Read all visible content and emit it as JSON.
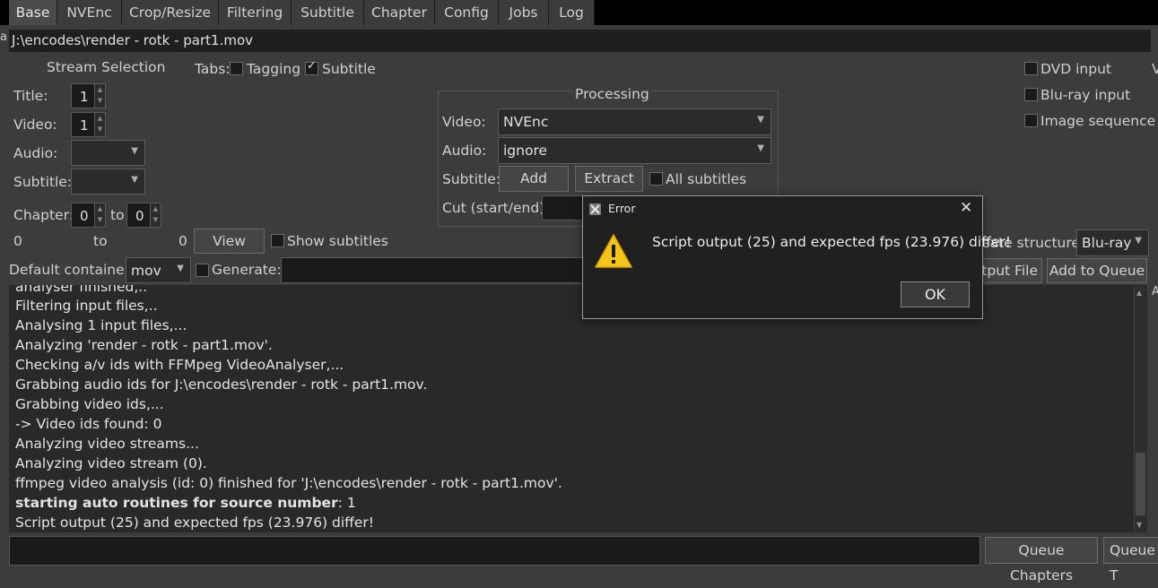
{
  "tabs": [
    "Base",
    "NVEnc",
    "Crop/Resize",
    "Filtering",
    "Subtitle",
    "Chapter",
    "Config",
    "Jobs",
    "Log"
  ],
  "left_mark": "a",
  "source_path": "J:\\encodes\\render - rotk - part1.mov",
  "stream_selection": {
    "title": "Stream Selection",
    "title_label": "Title:",
    "title_value": "1",
    "video_label": "Video:",
    "video_value": "1",
    "audio_label": "Audio:",
    "subtitle_label": "Subtitle:",
    "chapter_label": "Chapter:",
    "chapter_from": "0",
    "chapter_to_label": "to",
    "chapter_to": "0",
    "range_start": "0",
    "range_to": "to",
    "range_end": "0",
    "view_button": "View",
    "show_subtitles": "Show subtitles"
  },
  "tabs_options": {
    "label": "Tabs:",
    "tagging": "Tagging",
    "subtitle": "Subtitle"
  },
  "processing": {
    "title": "Processing",
    "video_label": "Video:",
    "video_value": "NVEnc",
    "audio_label": "Audio:",
    "audio_value": "ignore",
    "subtitle_label": "Subtitle:",
    "add_button": "Add",
    "extract_button": "Extract",
    "all_subtitles": "All subtitles",
    "cut_label": "Cut (start/end):"
  },
  "right_options": {
    "dvd_input": "DVD input",
    "bluray_input": "Blu-ray input",
    "image_sequence": "Image sequence",
    "edge_glyph": "V"
  },
  "container": {
    "label": "Default container:",
    "value": "mov",
    "generate": "Generate:",
    "structure_label": "eate structure:",
    "structure_value": "Blu-ray",
    "output_button": "tput File",
    "add_queue_button": "Add to Queue"
  },
  "log_lines": [
    "analyser finished,..",
    "Filtering input files,..",
    "Analysing 1 input files,...",
    "Analyzing 'render - rotk - part1.mov'.",
    " Checking a/v ids with FFMpeg VideoAnalyser,...",
    " Grabbing audio ids for J:\\encodes\\render - rotk - part1.mov.",
    " Grabbing video ids,...",
    "  -> Video ids found: 0",
    " Analyzing video streams...",
    "  Analyzing video stream (0).",
    "ffmpeg video analysis (id: 0) finished for 'J:\\encodes\\render - rotk - part1.mov'."
  ],
  "log_bold": {
    "prefix": "starting auto routines for source number",
    "suffix": ": 1"
  },
  "log_last": "Script output (25) and expected fps (23.976) differ!",
  "log_right_glyph": "A",
  "bottom": {
    "queue_chapters": "Queue Chapters",
    "queue_t": "Queue T"
  },
  "dialog": {
    "title": "Error",
    "message": "Script output (25) and expected fps (23.976) differ!",
    "ok": "OK"
  }
}
